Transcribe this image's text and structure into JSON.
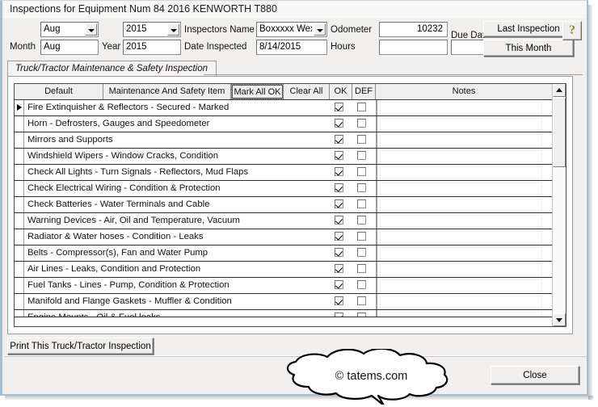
{
  "window": {
    "title": "Inspections for Equipment Num 84  2016 KENWORTH T880"
  },
  "form": {
    "month_label": "Month",
    "month_combo_value": "Aug",
    "month_text_value": "Aug",
    "year_label": "Year",
    "year_combo_value": "2015",
    "year_text_value": "2015",
    "inspectors_name_label": "Inspectors Name",
    "inspectors_name_value": "Boxxxxx Wex",
    "date_inspected_label": "Date Inspected",
    "date_inspected_value": "8/14/2015",
    "odometer_label": "Odometer",
    "odometer_value": "10232",
    "hours_label": "Hours",
    "hours_value": "",
    "due_date_label": "Due Date",
    "due_date_value": "",
    "last_inspection_label": "Last Inspection",
    "this_month_label": "This Month",
    "help_icon": "question-mark-icon",
    "help_glyph": "?"
  },
  "tabs": [
    {
      "label": "Truck/Tractor Maintenance & Safety Inspection",
      "active": true
    }
  ],
  "grid": {
    "headers": {
      "default": "Default",
      "item": "Maintenance And Safety Item",
      "mark_all_ok": "Mark All OK",
      "clear_all": "Clear All",
      "ok": "OK",
      "def": "DEF",
      "notes": "Notes"
    },
    "rows": [
      {
        "item": "Fire Extinquisher & Reflectors - Secured - Marked",
        "ok": true,
        "def": false,
        "notes": "",
        "selected": true
      },
      {
        "item": "Horn - Defrosters, Gauges and Speedometer",
        "ok": true,
        "def": false,
        "notes": "",
        "selected": false
      },
      {
        "item": "Mirrors and Supports",
        "ok": true,
        "def": false,
        "notes": "",
        "selected": false
      },
      {
        "item": "Windshield Wipers - Window Cracks, Condition",
        "ok": true,
        "def": false,
        "notes": "",
        "selected": false
      },
      {
        "item": "Check All Lights - Turn Signals - Reflectors, Mud Flaps",
        "ok": true,
        "def": false,
        "notes": "",
        "selected": false
      },
      {
        "item": "Check Electrical Wiring - Condition & Protection",
        "ok": true,
        "def": false,
        "notes": "",
        "selected": false
      },
      {
        "item": "Check Batteries - Water Terminals and Cable",
        "ok": true,
        "def": false,
        "notes": "",
        "selected": false
      },
      {
        "item": "Warning Devices - Air, Oil and Temperature, Vacuum",
        "ok": true,
        "def": false,
        "notes": "",
        "selected": false
      },
      {
        "item": "Radiator & Water hoses - Condition - Leaks",
        "ok": true,
        "def": false,
        "notes": "",
        "selected": false
      },
      {
        "item": "Belts - Compressor(s), Fan and Water Pump",
        "ok": true,
        "def": false,
        "notes": "",
        "selected": false
      },
      {
        "item": "Air Lines - Leaks, Condition and Protection",
        "ok": true,
        "def": false,
        "notes": "",
        "selected": false
      },
      {
        "item": "Fuel Tanks - Lines - Pump, Condition & Protection",
        "ok": true,
        "def": false,
        "notes": "",
        "selected": false
      },
      {
        "item": "Manifold and Flange Gaskets - Muffler & Condition",
        "ok": true,
        "def": false,
        "notes": "",
        "selected": false
      },
      {
        "item": "Engine Mounts - Oil & Fuel leaks",
        "ok": true,
        "def": false,
        "notes": "",
        "selected": false,
        "clipped": true
      }
    ],
    "scrollbar": {
      "up_icon": "scroll-up-arrow-icon",
      "down_icon": "scroll-down-arrow-icon"
    }
  },
  "footer": {
    "print_label": "Print This Truck/Tractor Inspection",
    "close_label": "Close",
    "watermark": "© tatems.com"
  },
  "colors": {
    "window_bg": "#f1f0ee",
    "frame_accent": "#9fc0d8",
    "help_glyph": "#8d8a2f",
    "grid_border": "#4a4a4a"
  }
}
